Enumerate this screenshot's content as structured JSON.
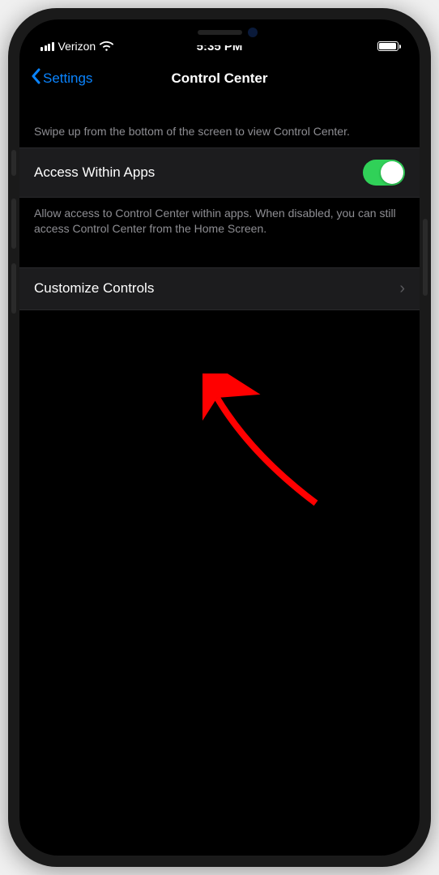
{
  "status": {
    "carrier": "Verizon",
    "time": "5:35 PM"
  },
  "nav": {
    "back_label": "Settings",
    "title": "Control Center"
  },
  "sections": {
    "top_help": "Swipe up from the bottom of the screen to view Control Center.",
    "access": {
      "label": "Access Within Apps",
      "footer": "Allow access to Control Center within apps. When disabled, you can still access Control Center from the Home Screen.",
      "enabled": true
    },
    "customize": {
      "label": "Customize Controls"
    }
  }
}
